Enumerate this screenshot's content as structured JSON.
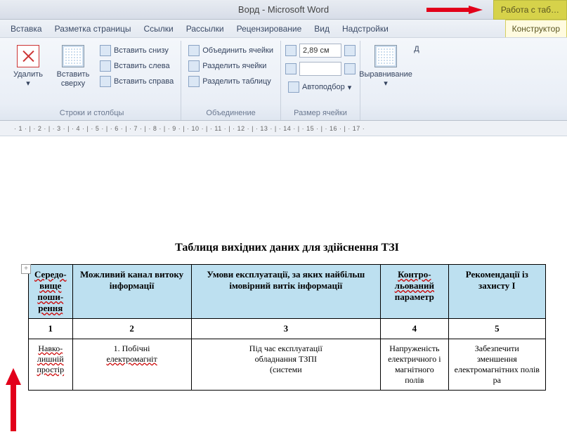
{
  "title": "Ворд - Microsoft Word",
  "context_tab": "Работа с таб…",
  "tabs": {
    "insert": "Вставка",
    "layout": "Разметка страницы",
    "refs": "Ссылки",
    "mail": "Рассылки",
    "review": "Рецензирование",
    "view": "Вид",
    "addins": "Надстройки",
    "design": "Конструктор"
  },
  "ribbon": {
    "rows_cols": {
      "delete": "Удалить",
      "insert_top": "Вставить сверху",
      "insert_bottom": "Вставить снизу",
      "insert_left": "Вставить слева",
      "insert_right": "Вставить справа",
      "label": "Строки и столбцы"
    },
    "merge": {
      "merge_cells": "Объединить ячейки",
      "split_cells": "Разделить ячейки",
      "split_table": "Разделить таблицу",
      "label": "Объединение"
    },
    "cell_size": {
      "height": "2,89 см",
      "autofit": "Автоподбор",
      "label": "Размер ячейки"
    },
    "align": {
      "alignment": "Выравнивание",
      "d": "Д"
    }
  },
  "ruler_text": "· 1 · | · 2 · | · 3 · | · 4 · | · 5 · | · 6 · | · 7 · | · 8 · | · 9 · | · 10 · | · 11 · | · 12 · | · 13 · | · 14 · | · 15 · | · 16 · | · 17 ·",
  "doc": {
    "title": "Таблиця вихідних даних для здійснення ТЗІ",
    "anchor": "+",
    "headers": {
      "c1a": "Середо-",
      "c1b": "вище",
      "c1c": "поши-",
      "c1d": "рення",
      "c2": "Можливий канал витоку інформації",
      "c3": "Умови експлуатації, за яких найбільш імовірний витік інформації",
      "c4a": "Контро-",
      "c4b": "льований",
      "c4c": "параметр",
      "c5": "Рекомендації із захисту І"
    },
    "nums": {
      "n1": "1",
      "n2": "2",
      "n3": "3",
      "n4": "4",
      "n5": "5"
    },
    "row1": {
      "c1a": "Навко-",
      "c1b": "лишній",
      "c1c": "простір",
      "c2a": "1. Побічні",
      "c2b": "електромагніт",
      "c3a": "Під час експлуатації",
      "c3b": "обладнання ТЗПІ",
      "c3c": "(системи",
      "c4a": "Напруженість",
      "c4b": "електричного і",
      "c4c": "магнітного полів",
      "c5a": "Забезпечити зменшення",
      "c5b": "електромагнітних полів ра"
    }
  }
}
